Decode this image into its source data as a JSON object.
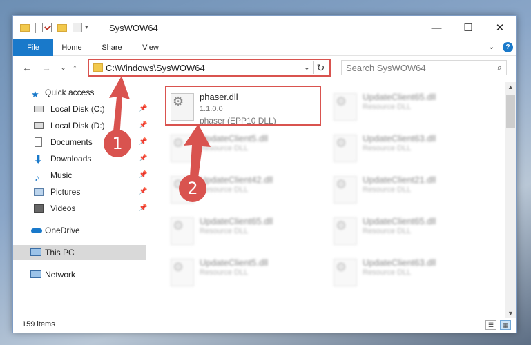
{
  "window": {
    "title": "SysWOW64"
  },
  "titlebar": {
    "dropdown_glyph": "▾",
    "minimize_glyph": "—",
    "maximize_glyph": "☐",
    "close_glyph": "✕"
  },
  "ribbon": {
    "tabs": [
      "File",
      "Home",
      "Share",
      "View"
    ],
    "expand_glyph": "⌄",
    "help_glyph": "?"
  },
  "nav": {
    "back_glyph": "←",
    "forward_glyph": "→",
    "recent_glyph": "⌄",
    "up_glyph": "↑",
    "address_path": "C:\\Windows\\SysWOW64",
    "address_dropdown_glyph": "⌄",
    "refresh_glyph": "↻",
    "search_placeholder": "Search SysWOW64",
    "search_glyph": "⌕"
  },
  "sidebar": {
    "quick_access": "Quick access",
    "items": [
      {
        "label": "Local Disk (C:)",
        "icon": "drive-icon",
        "pinned": true
      },
      {
        "label": "Local Disk (D:)",
        "icon": "drive-icon",
        "pinned": true
      },
      {
        "label": "Documents",
        "icon": "documents-icon",
        "pinned": true
      },
      {
        "label": "Downloads",
        "icon": "downloads-icon",
        "pinned": true
      },
      {
        "label": "Music",
        "icon": "music-icon",
        "pinned": true
      },
      {
        "label": "Pictures",
        "icon": "pictures-icon",
        "pinned": true
      },
      {
        "label": "Videos",
        "icon": "videos-icon",
        "pinned": true
      }
    ],
    "pin_glyph": "📌",
    "onedrive": "OneDrive",
    "this_pc": "This PC",
    "network": "Network"
  },
  "files": [
    {
      "name": "phaser.dll",
      "version": "1.1.0.0",
      "description": "phaser (EPP10 DLL)",
      "highlighted": true
    },
    {
      "name": "UpdateClient65.dll",
      "description": "Resource DLL"
    },
    {
      "name": "UpdateClient5.dll",
      "description": "Resource DLL"
    },
    {
      "name": "UpdateClient63.dll",
      "description": "Resource DLL"
    },
    {
      "name": "UpdateClient42.dll",
      "description": "Resource DLL"
    },
    {
      "name": "UpdateClient21.dll",
      "description": "Resource DLL"
    },
    {
      "name": "UpdateClient65.dll",
      "description": "Resource DLL"
    },
    {
      "name": "UpdateClient65.dll",
      "description": "Resource DLL"
    },
    {
      "name": "UpdateClient5.dll",
      "description": "Resource DLL"
    },
    {
      "name": "UpdateClient63.dll",
      "description": "Resource DLL"
    }
  ],
  "status": {
    "item_count": "159 items"
  },
  "annotations": {
    "step1": "1",
    "step2": "2"
  },
  "colors": {
    "accent": "#1979ca",
    "annotation": "#d9534f",
    "folder": "#f2c94c"
  }
}
